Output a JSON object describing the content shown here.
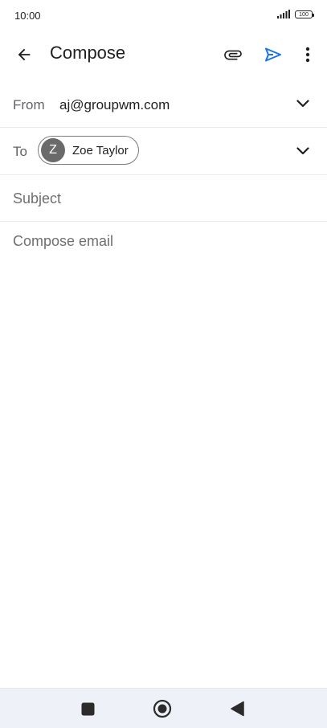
{
  "status_bar": {
    "time": "10:00",
    "battery": "100",
    "icons": [
      "signal-icon",
      "battery-icon"
    ]
  },
  "app_bar": {
    "title": "Compose",
    "icons": [
      "back-arrow-icon",
      "paperclip-icon",
      "send-icon",
      "more-vertical-icon"
    ]
  },
  "from": {
    "label": "From",
    "value": "aj@groupwm.com"
  },
  "to": {
    "label": "To",
    "recipients": [
      {
        "initial": "Z",
        "name": "Zoe Taylor"
      }
    ]
  },
  "subject": {
    "placeholder": "Subject",
    "value": ""
  },
  "body": {
    "placeholder": "Compose email",
    "value": ""
  },
  "nav_bar": {
    "icons": [
      "recents-square-icon",
      "home-circle-icon",
      "back-triangle-icon"
    ]
  },
  "colors": {
    "accent": "#1a73e8",
    "text": "#1f1f1f",
    "secondary_text": "#5f6368",
    "chip_avatar": "#6a6a6a",
    "nav_background": "#eef1f8"
  }
}
